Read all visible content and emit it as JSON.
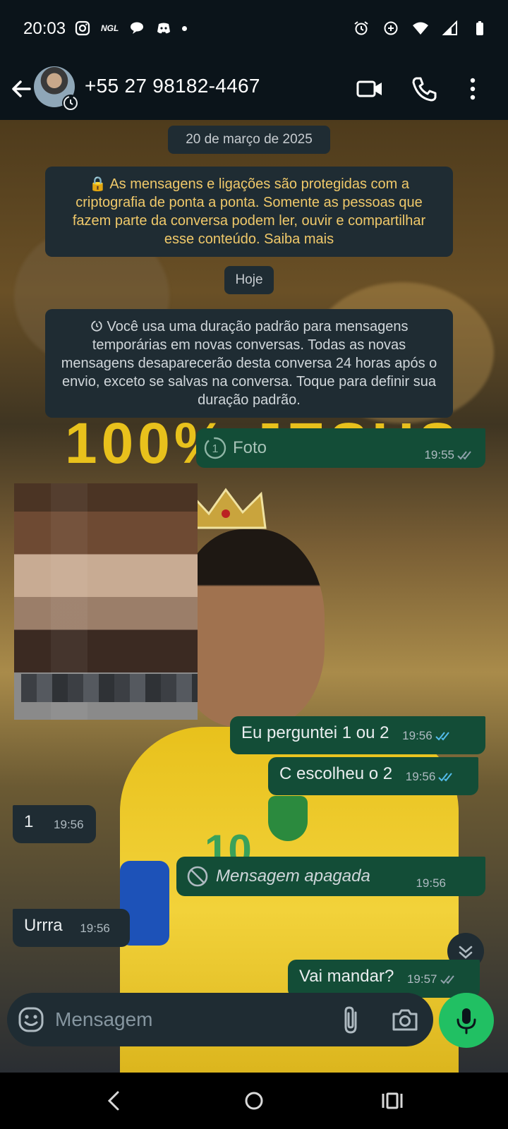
{
  "status_bar": {
    "time": "20:03",
    "ngl_label": "NGL",
    "left_icons": [
      "instagram-icon",
      "ngl-icon",
      "chat-bubbles-icon",
      "discord-icon",
      "dot-icon"
    ],
    "right_icons": [
      "alarm-icon",
      "data-saver-icon",
      "wifi-icon",
      "signal-icon",
      "battery-icon"
    ]
  },
  "header": {
    "contact_name": "+55 27 98182-4467",
    "icons": [
      "back-arrow-icon",
      "video-call-icon",
      "phone-call-icon",
      "more-options-icon"
    ]
  },
  "chat": {
    "date_pill": "20 de março de 2025",
    "encryption_notice": "🔒 As mensagens e ligações são protegidas com a criptografia de ponta a ponta. Somente as pessoas que fazem parte da conversa podem ler, ouvir e compartilhar esse conteúdo. Saiba mais",
    "today_pill": "Hoje",
    "disappearing_notice": "Você usa uma duração padrão para mensagens temporárias em novas conversas. Todas as novas mensagens desaparecerão desta conversa 24 horas após o envio, exceto se salvas na conversa. Toque para definir sua duração padrão.",
    "messages": [
      {
        "direction": "out",
        "text": "Foto",
        "time": "19:55",
        "type": "view-once-photo",
        "status": "read"
      },
      {
        "direction": "out",
        "text": "Eu perguntei 1 ou 2",
        "time": "19:56",
        "status": "read"
      },
      {
        "direction": "out",
        "text": "C escolheu o 2",
        "time": "19:56",
        "status": "read"
      },
      {
        "direction": "in",
        "text": "1",
        "time": "19:56"
      },
      {
        "direction": "out",
        "text": "Mensagem apagada",
        "time": "19:56",
        "type": "deleted"
      },
      {
        "direction": "in",
        "text": "Urrra",
        "time": "19:56"
      },
      {
        "direction": "out",
        "text": "Vai mandar?",
        "time": "19:57",
        "status": "read"
      }
    ]
  },
  "composer": {
    "placeholder": "Mensagem",
    "icons": [
      "emoji-icon",
      "attach-icon",
      "camera-icon",
      "mic-icon"
    ]
  },
  "nav_bar": {
    "icons": [
      "nav-back-icon",
      "nav-home-icon",
      "nav-recents-icon"
    ]
  },
  "colors": {
    "header_bg": "#0b141a",
    "bubble_out": "#134d37",
    "bubble_in": "#1f2c33",
    "accent_green": "#21c063",
    "read_ticks": "#53bdeb"
  }
}
